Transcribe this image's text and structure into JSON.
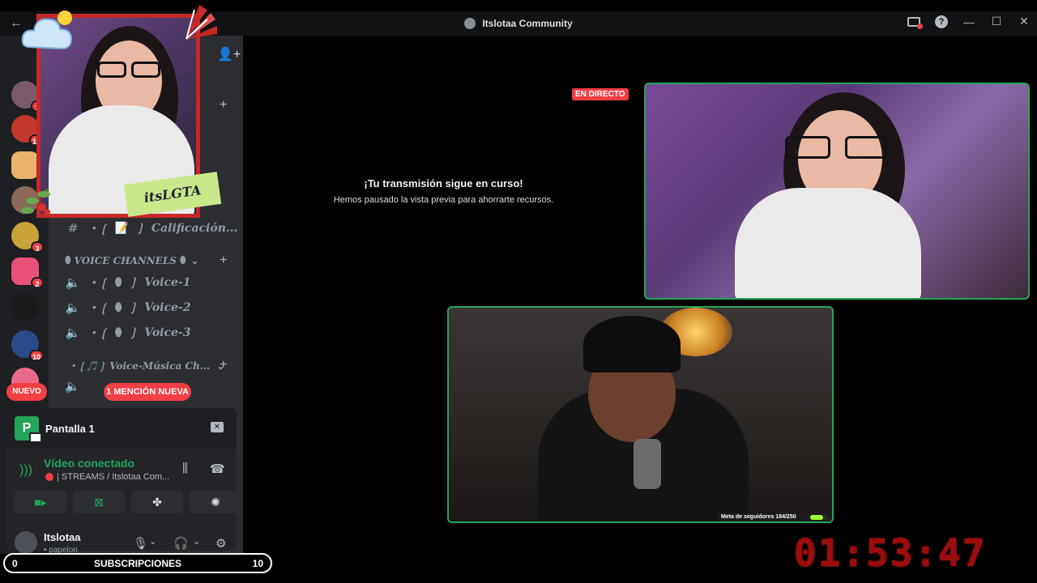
{
  "window": {
    "title": "Itslotaa Community"
  },
  "sidebar": {
    "server_badges": [
      "1",
      "18",
      "3",
      "2",
      "10"
    ],
    "nuevo_label": "NUEVO",
    "mention_label": "1 MENCIÓN NUEVA",
    "overlay_tag": "itsLGTA",
    "channels": [
      {
        "prefix": "・❲",
        "icon": "📝",
        "suffix": "❳",
        "name": "Calificación..."
      }
    ],
    "voice_category": "VOICE CHANNELS",
    "voice_channels": [
      {
        "prefix": "・❲",
        "suffix": "❳",
        "name": "Voice-1"
      },
      {
        "prefix": "・❲",
        "suffix": "❳",
        "name": "Voice-2"
      },
      {
        "prefix": "・❲",
        "suffix": "❳",
        "name": "Voice-3"
      }
    ],
    "music_category": "・❲🎵❳ Voice-Música Ch..."
  },
  "panel": {
    "stream_title": "Pantalla 1",
    "stream_thumb_letter": "P",
    "connection_status": "Vídeo conectado",
    "connection_channel": "| STREAMS / Itslotaa Com...",
    "user_name": "Itslotaa",
    "user_status": "• papelon"
  },
  "stage": {
    "live_badge": "EN DIRECTO",
    "paused_title": "¡Tu transmisión sigue en curso!",
    "paused_subtitle": "Hemos pausado la vista previa para ahorrarte recursos.",
    "follower_goal_label": "Meta de seguidores 184/250",
    "follower_goal_progress": 0.736
  },
  "overlay": {
    "subs_left": "0",
    "subs_label": "SUBSCRIPCIONES",
    "subs_right": "10",
    "timer": "01:53:47"
  },
  "colors": {
    "accent_green": "#23a559",
    "alert_red": "#f23f43",
    "timer_red": "#9c0d0d"
  }
}
